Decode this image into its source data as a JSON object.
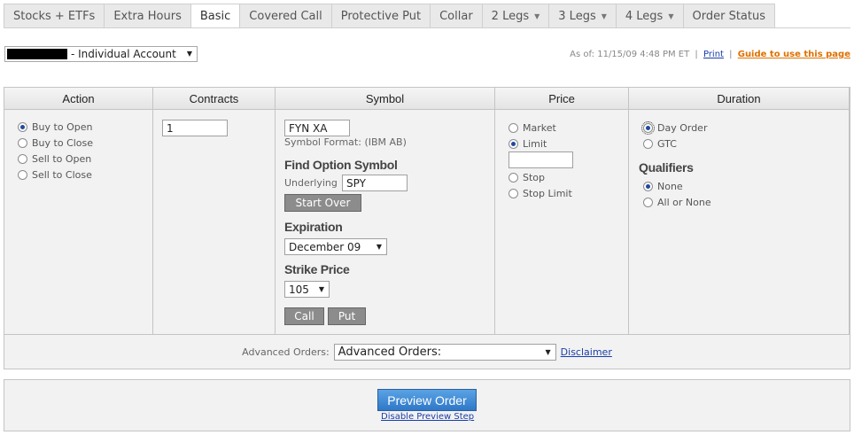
{
  "tabs": [
    {
      "label": "Stocks + ETFs",
      "active": false,
      "dropdown": false
    },
    {
      "label": "Extra Hours",
      "active": false,
      "dropdown": false
    },
    {
      "label": "Basic",
      "active": true,
      "dropdown": false
    },
    {
      "label": "Covered Call",
      "active": false,
      "dropdown": false
    },
    {
      "label": "Protective Put",
      "active": false,
      "dropdown": false
    },
    {
      "label": "Collar",
      "active": false,
      "dropdown": false
    },
    {
      "label": "2 Legs",
      "active": false,
      "dropdown": true
    },
    {
      "label": "3 Legs",
      "active": false,
      "dropdown": true
    },
    {
      "label": "4 Legs",
      "active": false,
      "dropdown": true
    },
    {
      "label": "Order Status",
      "active": false,
      "dropdown": false
    }
  ],
  "account": {
    "label": "- Individual Account"
  },
  "header": {
    "as_of": "As of: 11/15/09 4:48 PM ET",
    "print": "Print",
    "separator": "|",
    "guide": "Guide to use this page"
  },
  "columns": {
    "action": "Action",
    "contracts": "Contracts",
    "symbol": "Symbol",
    "price": "Price",
    "duration": "Duration"
  },
  "action": {
    "options": [
      {
        "label": "Buy to Open",
        "selected": true
      },
      {
        "label": "Buy to Close",
        "selected": false
      },
      {
        "label": "Sell to Open",
        "selected": false
      },
      {
        "label": "Sell to Close",
        "selected": false
      }
    ]
  },
  "contracts": {
    "value": "1"
  },
  "symbol": {
    "value": "FYN XA",
    "format_note": "Symbol Format: (IBM AB)",
    "find_heading": "Find Option Symbol",
    "underlying_label": "Underlying",
    "underlying_value": "SPY",
    "start_over": "Start Over",
    "expiration_heading": "Expiration",
    "expiration_value": "December 09",
    "strike_heading": "Strike Price",
    "strike_value": "105",
    "call": "Call",
    "put": "Put"
  },
  "price": {
    "options": [
      {
        "label": "Market",
        "selected": false
      },
      {
        "label": "Limit",
        "selected": true
      },
      {
        "label": "Stop",
        "selected": false
      },
      {
        "label": "Stop Limit",
        "selected": false
      }
    ],
    "limit_value": ""
  },
  "duration": {
    "options": [
      {
        "label": "Day Order",
        "selected": true
      },
      {
        "label": "GTC",
        "selected": false
      }
    ],
    "qualifiers_heading": "Qualifiers",
    "qualifiers": [
      {
        "label": "None",
        "selected": true
      },
      {
        "label": "All or None",
        "selected": false
      }
    ]
  },
  "advanced": {
    "label": "Advanced Orders:",
    "select_value": "Advanced Orders:",
    "disclaimer": "Disclaimer"
  },
  "preview": {
    "button": "Preview Order",
    "disable_link": "Disable Preview Step"
  },
  "colors": {
    "preview_button": "#3b86d1",
    "link": "#1a3ea8",
    "guide_link": "#e07000"
  }
}
